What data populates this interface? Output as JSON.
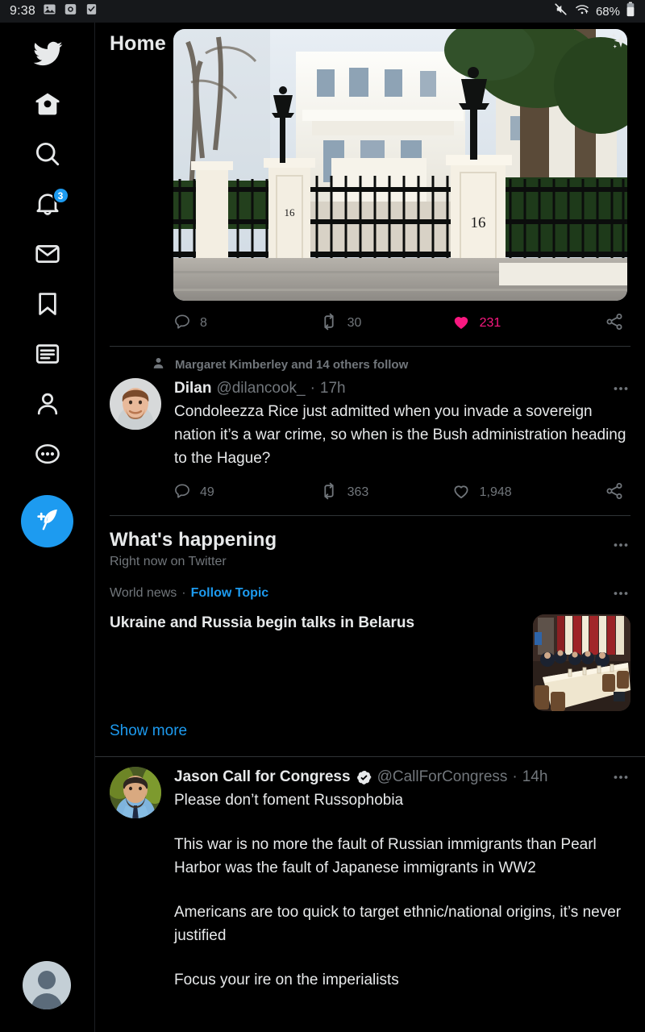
{
  "status_bar": {
    "time": "9:38",
    "battery_percent": "68%",
    "left_icons": [
      "image-icon",
      "screenshot-icon",
      "checkbox-icon"
    ],
    "right_icons": [
      "mute-icon",
      "wifi-icon",
      "battery-icon"
    ]
  },
  "sidebar": {
    "items": [
      {
        "name": "twitter-logo",
        "label": "Twitter"
      },
      {
        "name": "home",
        "label": "Home"
      },
      {
        "name": "search",
        "label": "Search"
      },
      {
        "name": "notifications",
        "label": "Notifications",
        "badge": "3"
      },
      {
        "name": "messages",
        "label": "Messages"
      },
      {
        "name": "bookmarks",
        "label": "Bookmarks"
      },
      {
        "name": "lists",
        "label": "Lists"
      },
      {
        "name": "profile",
        "label": "Profile"
      },
      {
        "name": "more",
        "label": "More"
      }
    ],
    "compose_label": "Tweet",
    "account_avatar_label": "Account"
  },
  "header": {
    "title": "Home",
    "sparkle_label": "Top Tweets"
  },
  "colors": {
    "accent_blue": "#1D9BF0",
    "like_pink": "#F91880",
    "text_primary": "#E7E9EA",
    "text_secondary": "#71767B",
    "background": "#000000",
    "divider": "#2F3336"
  },
  "tweets": [
    {
      "id": "tweet-media",
      "media_alt": "White mansion behind ornate black iron gates with pillars numbered 16",
      "actions": {
        "reply_count": "8",
        "retweet_count": "30",
        "like_count": "231",
        "liked": true,
        "share_label": "Share"
      }
    },
    {
      "id": "tweet-dilan",
      "social_context": "Margaret Kimberley and 14 others follow",
      "name": "Dilan",
      "handle": "@dilancook_",
      "separator": "·",
      "time": "17h",
      "verified": false,
      "paragraphs": [
        "Condoleezza Rice just admitted when you invade a sovereign nation it’s a war crime, so when is the Bush administration heading to the Hague?"
      ],
      "actions": {
        "reply_count": "49",
        "retweet_count": "363",
        "like_count": "1,948",
        "liked": false,
        "share_label": "Share"
      }
    },
    {
      "id": "tweet-jason-call",
      "name": "Jason Call for Congress",
      "handle": "@CallForCongress",
      "separator": "·",
      "time": "14h",
      "verified": true,
      "paragraphs": [
        "Please don’t foment Russophobia",
        "This war is no more the fault of Russian immigrants than Pearl Harbor was the fault of Japanese immigrants in WW2",
        "Americans are too quick to target ethnic/national origins, it’s never justified",
        "Focus your ire on the imperialists"
      ]
    }
  ],
  "whats_happening": {
    "title": "What's happening",
    "subtitle": "Right now on Twitter",
    "topic": {
      "category": "World news",
      "separator": "·",
      "follow_label": "Follow Topic",
      "headline": "Ukraine and Russia begin talks in Belarus",
      "thumbnail_alt": "Delegations seated at a long negotiating table"
    },
    "show_more_label": "Show more"
  }
}
